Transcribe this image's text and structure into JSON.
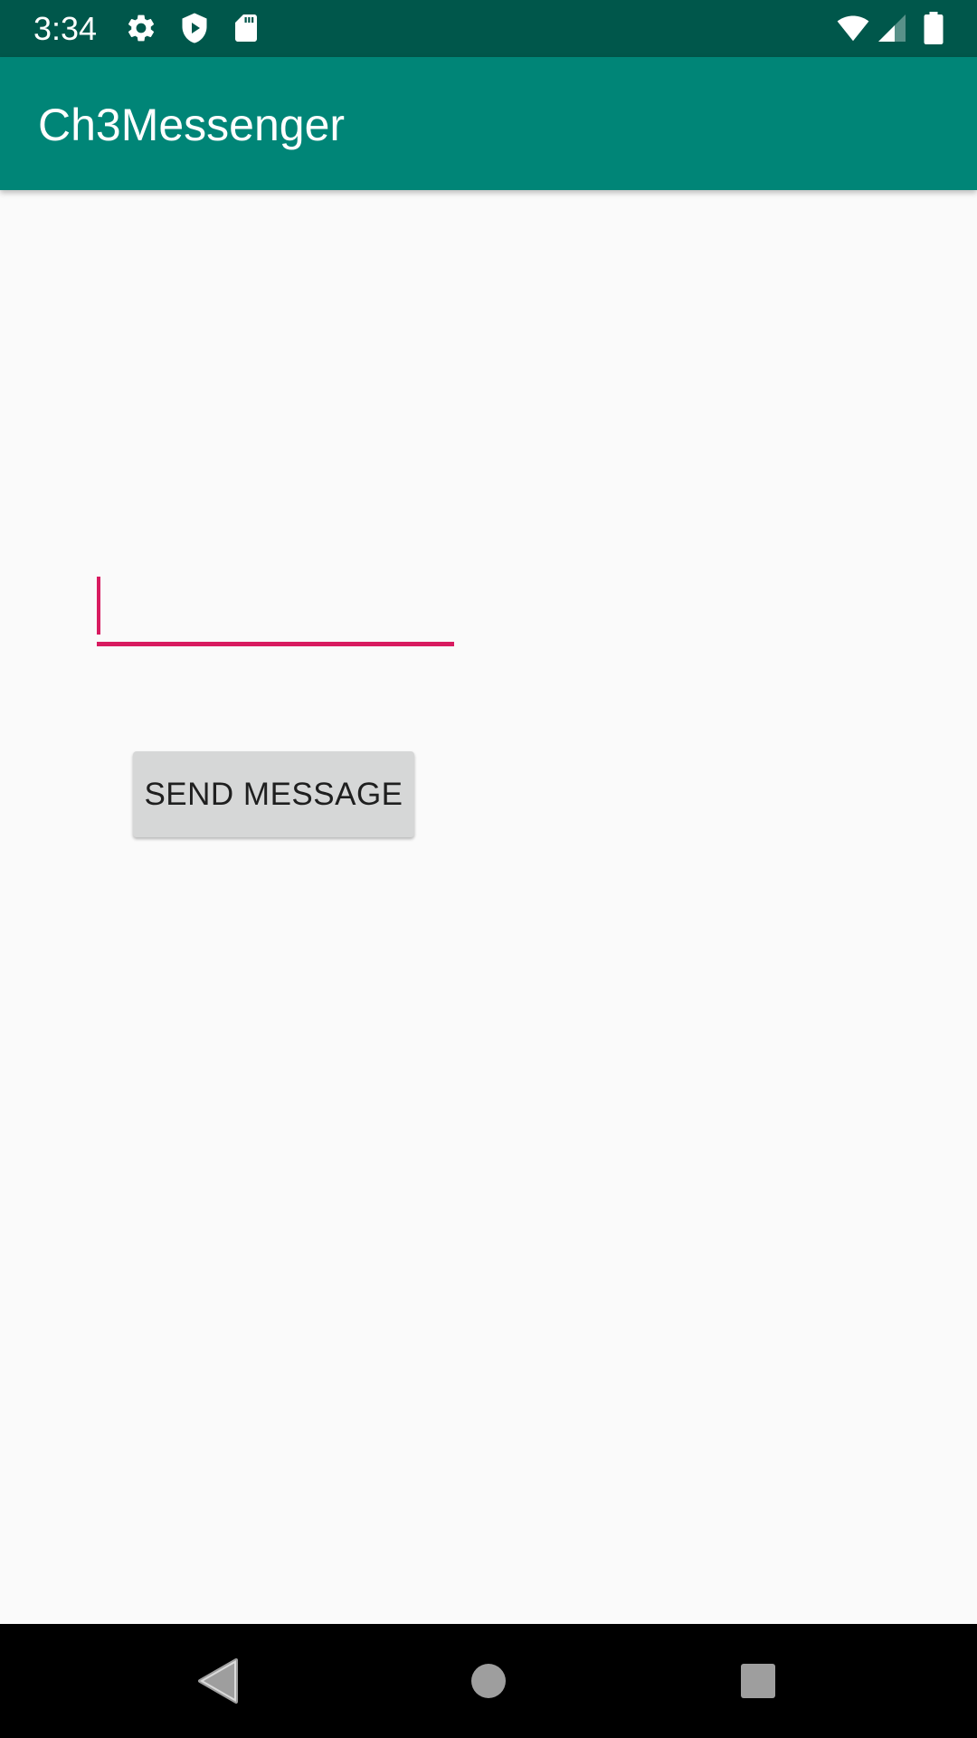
{
  "status_bar": {
    "time": "3:34",
    "icons_left": [
      "settings-icon",
      "shield-play-icon",
      "sd-card-icon"
    ],
    "icons_right": [
      "wifi-icon",
      "signal-icon",
      "battery-icon"
    ],
    "background_color": "#00574b"
  },
  "app_bar": {
    "title": "Ch3Messenger",
    "background_color": "#008577"
  },
  "main": {
    "message_input": {
      "value": "",
      "placeholder": ""
    },
    "send_button_label": "SEND MESSAGE",
    "accent_color": "#d81b60"
  },
  "nav_bar": {
    "items": [
      "back-icon",
      "home-icon",
      "recents-icon"
    ]
  }
}
